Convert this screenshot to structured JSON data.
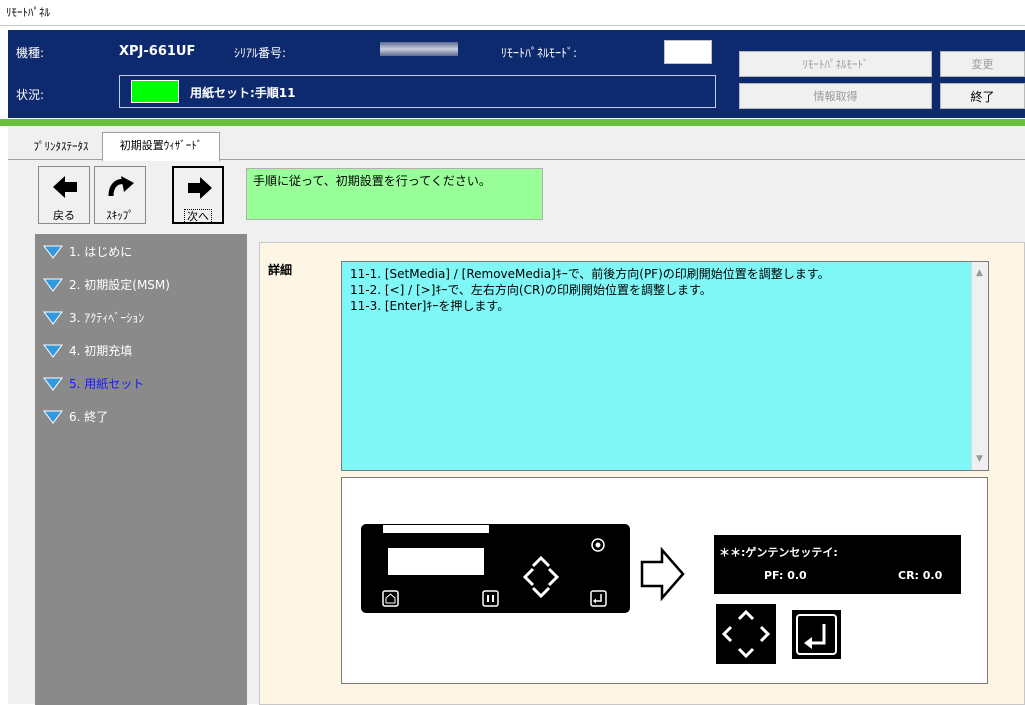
{
  "window": {
    "title": "ﾘﾓｰﾄﾊﾟﾈﾙ"
  },
  "header": {
    "model_label": "機種:",
    "model_value": "XPJ-661UF",
    "serial_label": "ｼﾘｱﾙ番号:",
    "remote_mode_label": "ﾘﾓｰﾄﾊﾟﾈﾙﾓｰﾄﾞ:",
    "status_label": "状況:",
    "status_text": "用紙セット:手順11",
    "status_color": "#00ff00",
    "buttons": {
      "remote_panel_mode": "ﾘﾓｰﾄﾊﾟﾈﾙﾓｰﾄﾞ",
      "change": "変更",
      "get_info": "情報取得",
      "exit": "終了"
    }
  },
  "tabs": [
    {
      "label": "ﾌﾟﾘﾝﾀｽﾃｰﾀｽ"
    },
    {
      "label": "初期設置ｳｨｻﾞｰﾄﾞ"
    }
  ],
  "wizard": {
    "nav": {
      "back": "戻る",
      "skip": "ｽｷｯﾌﾟ",
      "next": "次へ"
    },
    "message": "手順に従って、初期設置を行ってください。",
    "steps": [
      {
        "label": "1. はじめに"
      },
      {
        "label": "2. 初期設定(MSM)"
      },
      {
        "label": "3. ｱｸﾃｨﾍﾞｰｼｮﾝ"
      },
      {
        "label": "4. 初期充填"
      },
      {
        "label": "5. 用紙セット"
      },
      {
        "label": "6. 終了"
      }
    ],
    "detail_label": "詳細",
    "detail_lines": [
      "11-1. [SetMedia] / [RemoveMedia]ｷｰで、前後方向(PF)の印刷開始位置を調整します。",
      "11-2. [<] / [>]ｷｰで、左右方向(CR)の印刷開始位置を調整します。",
      "11-3. [Enter]ｷｰを押します。"
    ],
    "lcd": {
      "line1": "＊＊:ゲンテンセッテイ:",
      "pf": "PF: 0.0",
      "cr": "CR: 0.0"
    }
  },
  "colors": {
    "header_bg": "#0e2a6e",
    "accent_green": "#6abf3c",
    "message_bg": "#99ff99",
    "detail_bg": "#7ff7f7",
    "steps_bg": "#8a8a8a",
    "active_step": "#1a1aff",
    "triangle": "#3399dd"
  }
}
